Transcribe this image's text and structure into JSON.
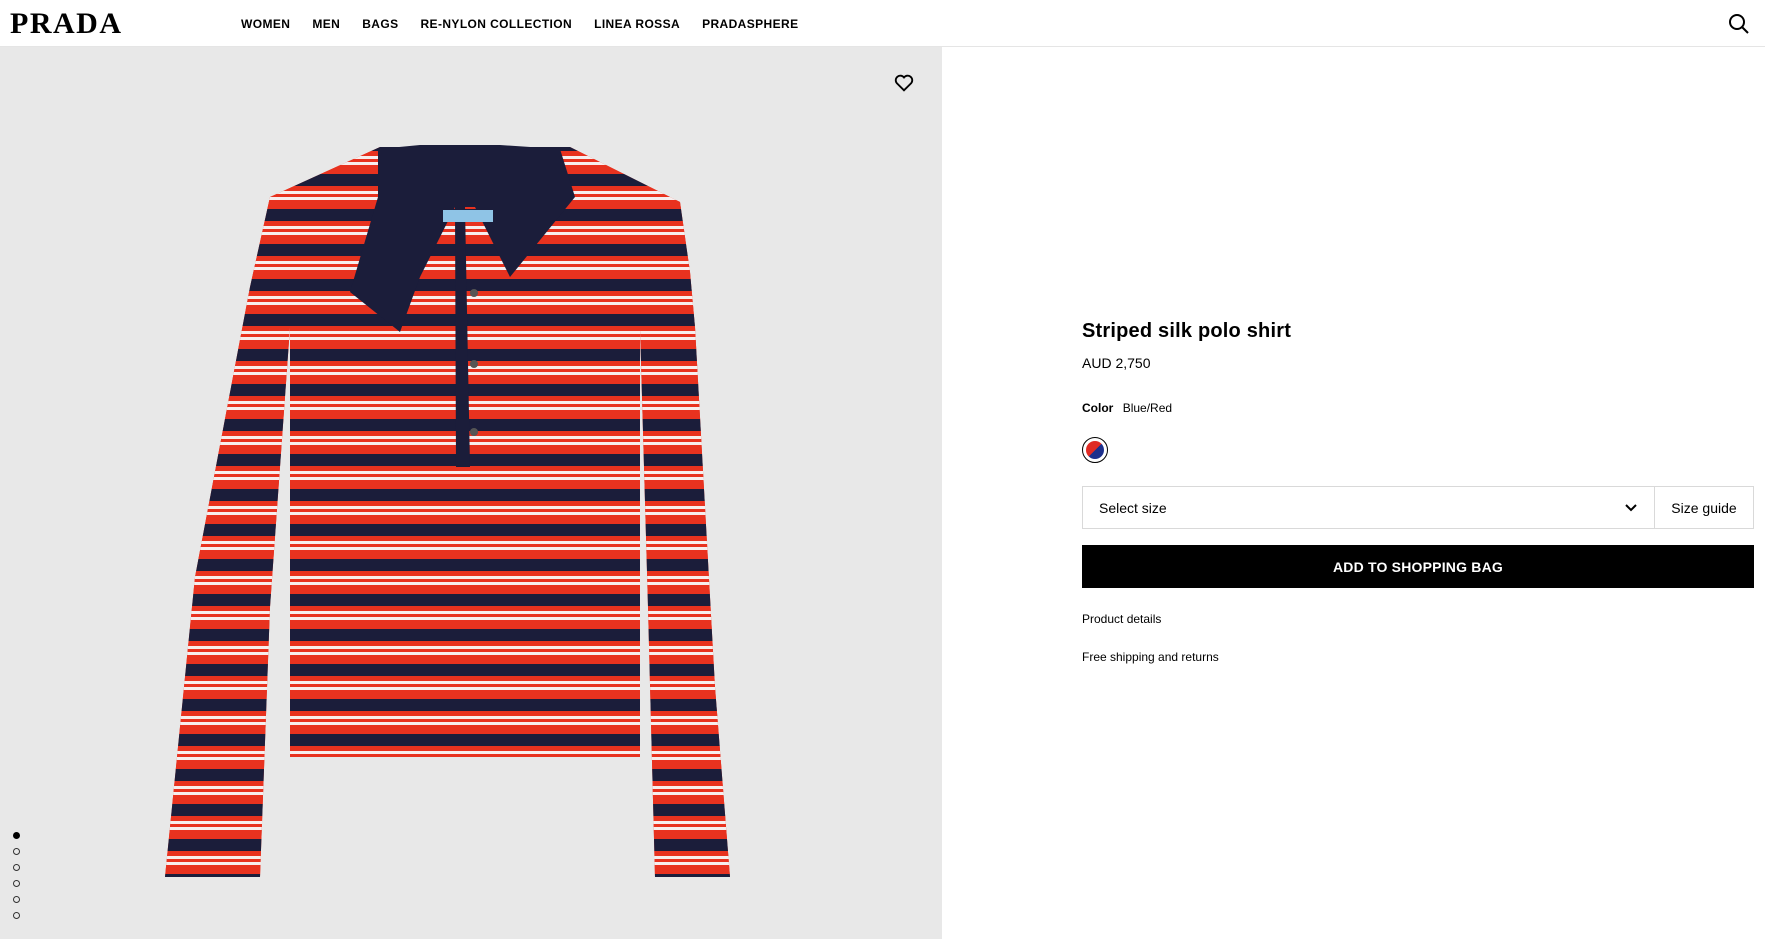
{
  "brand": {
    "logo": "PRADA"
  },
  "nav": [
    {
      "label": "WOMEN"
    },
    {
      "label": "MEN"
    },
    {
      "label": "BAGS"
    },
    {
      "label": "RE-NYLON COLLECTION"
    },
    {
      "label": "LINEA ROSSA"
    },
    {
      "label": "PRADASPHERE"
    }
  ],
  "gallery": {
    "image_count": 6,
    "active_index": 0,
    "icons": {
      "favorite": "heart-icon",
      "search": "search-icon"
    }
  },
  "product": {
    "title": "Striped silk polo shirt",
    "price": "AUD 2,750",
    "color_label": "Color",
    "color_value": "Blue/Red",
    "size_placeholder": "Select size",
    "size_guide": "Size guide",
    "add_to_bag": "ADD TO SHOPPING BAG",
    "details_link": "Product details",
    "shipping_link": "Free shipping and returns"
  },
  "colors": {
    "stripe_red": "#e8321f",
    "stripe_navy": "#1b1d3a",
    "stripe_white": "#f7eeee",
    "swatch_red": "#e02a24",
    "swatch_blue": "#1c2f8c"
  }
}
